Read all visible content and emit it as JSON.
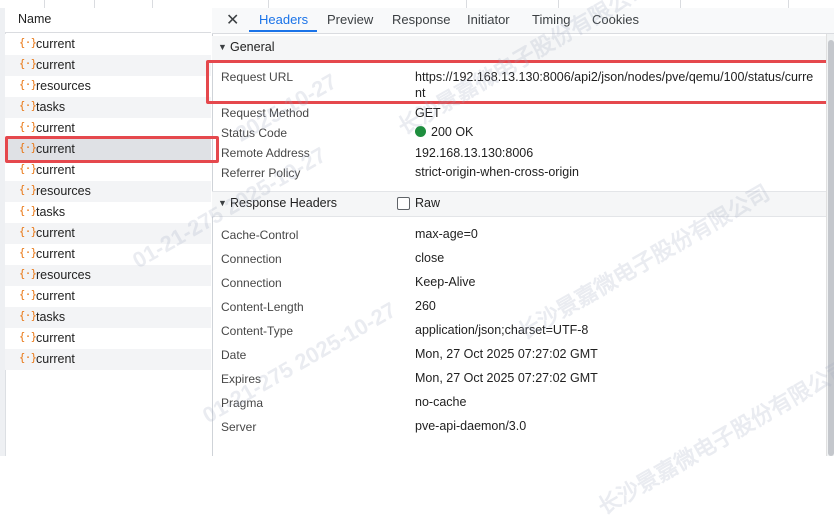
{
  "request_list": {
    "header": "Name",
    "icon": "{·}",
    "selected_index": 5,
    "items": [
      "current",
      "current",
      "resources",
      "tasks",
      "current",
      "current",
      "current",
      "resources",
      "tasks",
      "current",
      "current",
      "resources",
      "current",
      "tasks",
      "current",
      "current"
    ]
  },
  "tabs": {
    "close": "✕",
    "items": [
      "Headers",
      "Preview",
      "Response",
      "Initiator",
      "Timing",
      "Cookies"
    ],
    "active": "Headers"
  },
  "general": {
    "title": "General",
    "rows": [
      {
        "key": "Request URL",
        "value": "https://192.168.13.130:8006/api2/json/nodes/pve/qemu/100/status/current"
      },
      {
        "key": "Request Method",
        "value": "GET"
      },
      {
        "key": "Status Code",
        "value": "200 OK",
        "status_color": "#1e8e3e"
      },
      {
        "key": "Remote Address",
        "value": "192.168.13.130:8006"
      },
      {
        "key": "Referrer Policy",
        "value": "strict-origin-when-cross-origin"
      }
    ]
  },
  "response_headers": {
    "title": "Response Headers",
    "raw_label": "Raw",
    "raw_checked": false,
    "rows": [
      {
        "key": "Cache-Control",
        "value": "max-age=0"
      },
      {
        "key": "Connection",
        "value": "close"
      },
      {
        "key": "Connection",
        "value": "Keep-Alive"
      },
      {
        "key": "Content-Length",
        "value": "260"
      },
      {
        "key": "Content-Type",
        "value": "application/json;charset=UTF-8"
      },
      {
        "key": "Date",
        "value": "Mon, 27 Oct 2025 07:27:02 GMT"
      },
      {
        "key": "Expires",
        "value": "Mon, 27 Oct 2025 07:27:02 GMT"
      },
      {
        "key": "Pragma",
        "value": "no-cache"
      },
      {
        "key": "Server",
        "value": "pve-api-daemon/3.0"
      }
    ]
  },
  "watermark": {
    "texts": [
      "长沙景嘉微电子股份有限公司",
      "2025-10-27",
      "01-21-275 2025-10-27",
      "长沙景嘉微电子股份有限公司",
      "01-21-275 2025-10-27",
      "长沙景嘉微电子股份有限公司"
    ]
  },
  "colors": {
    "accent": "#1a73e8",
    "highlight": "#e5484d",
    "icon": "#e8710a",
    "status_ok": "#1e8e3e"
  }
}
